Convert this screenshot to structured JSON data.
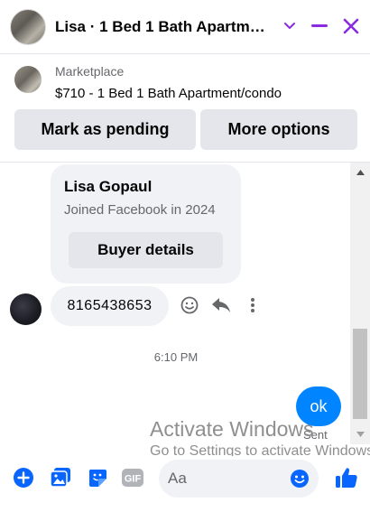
{
  "header": {
    "title": "Lisa · 1 Bed 1 Bath Apartm…"
  },
  "marketplace": {
    "source": "Marketplace",
    "listing": "$710 - 1 Bed 1 Bath Apartment/condo",
    "actions": [
      "Mark as pending",
      "More options"
    ]
  },
  "profile_card": {
    "name": "Lisa Gopaul",
    "joined": "Joined Facebook in 2024",
    "button": "Buyer details"
  },
  "messages": {
    "incoming": "8165438653",
    "timestamp": "6:10 PM",
    "outgoing": "ok",
    "status": "Sent"
  },
  "composer": {
    "placeholder": "Aa"
  },
  "watermark": {
    "line1": "Activate Windows",
    "line2": "Go to Settings to activate Windows."
  },
  "colors": {
    "accent": "#0084ff",
    "header_icons": "#8a2be2",
    "composer_icons": "#0866ff",
    "bubble_bg": "#f0f2f5",
    "button_bg": "#e4e6eb"
  },
  "icons": {
    "header": [
      "chevron-down-icon",
      "minimize-icon",
      "close-icon"
    ],
    "message_actions": [
      "emoji-react-icon",
      "reply-icon",
      "more-icon"
    ],
    "composer": [
      "plus-icon",
      "photo-icon",
      "sticker-icon",
      "gif-icon",
      "emoji-icon",
      "thumbs-up-icon"
    ]
  }
}
